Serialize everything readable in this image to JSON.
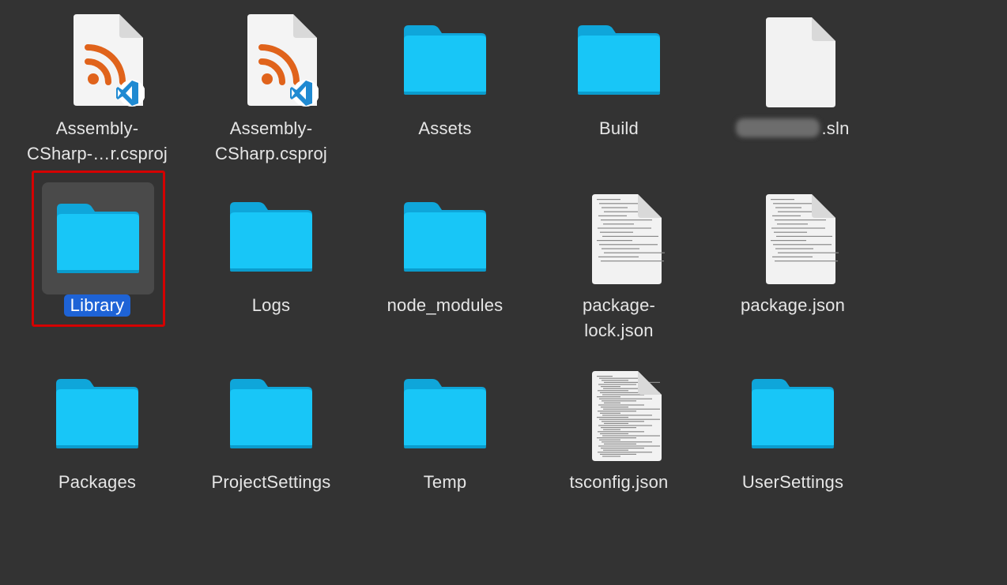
{
  "colors": {
    "background": "#333333",
    "folder": "#18c6f7",
    "selection": "#1e63d6",
    "highlight": "#d40000",
    "label": "#e6e6e6"
  },
  "items": [
    {
      "label": "Assembly-\nCSharp-…r.csproj",
      "icon": "csproj-rss-vscode-icon",
      "selected": false
    },
    {
      "label": "Assembly-\nCSharp.csproj",
      "icon": "csproj-rss-vscode-icon",
      "selected": false
    },
    {
      "label": "Assets",
      "icon": "folder-icon",
      "selected": false
    },
    {
      "label": "Build",
      "icon": "folder-icon",
      "selected": false
    },
    {
      "label": ".sln",
      "icon": "blank-document-icon",
      "selected": false,
      "name_blurred": true
    },
    {
      "label": "Library",
      "icon": "folder-icon",
      "selected": true
    },
    {
      "label": "Logs",
      "icon": "folder-icon",
      "selected": false
    },
    {
      "label": "node_modules",
      "icon": "folder-icon",
      "selected": false
    },
    {
      "label": "package-\nlock.json",
      "icon": "text-document-icon",
      "selected": false
    },
    {
      "label": "package.json",
      "icon": "text-document-icon",
      "selected": false
    },
    {
      "label": "Packages",
      "icon": "folder-icon",
      "selected": false
    },
    {
      "label": "ProjectSettings",
      "icon": "folder-icon",
      "selected": false
    },
    {
      "label": "Temp",
      "icon": "folder-icon",
      "selected": false
    },
    {
      "label": "tsconfig.json",
      "icon": "text-document-icon",
      "selected": false
    },
    {
      "label": "UserSettings",
      "icon": "folder-icon",
      "selected": false
    }
  ]
}
